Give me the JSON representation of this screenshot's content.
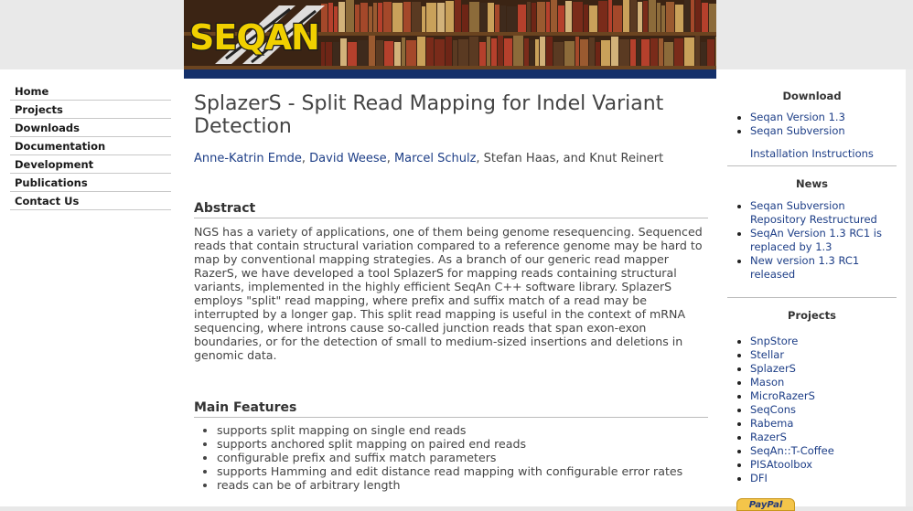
{
  "logo": {
    "text": "SEQAN"
  },
  "nav": {
    "items": [
      "Home",
      "Projects",
      "Downloads",
      "Documentation",
      "Development",
      "Publications",
      "Contact Us"
    ]
  },
  "main": {
    "title": "SplazerS - Split Read Mapping for Indel Variant Detection",
    "authors": {
      "links": [
        "Anne-Katrin Emde",
        "David Weese",
        "Marcel Schulz"
      ],
      "sep": ", ",
      "rest": ", Stefan Haas, and Knut Reinert"
    },
    "abstract_heading": "Abstract",
    "abstract_text": "NGS has a variety of applications, one of them being genome resequencing. Sequenced reads that contain structural variation compared to a reference genome may be hard to map by conventional mapping strategies. As a branch of our generic read mapper RazerS, we have developed a tool SplazerS for mapping reads containing structural variants, implemented in the highly efficient SeqAn C++ software library. SplazerS employs \"split\" read mapping, where prefix and suffix match of a read may be interrupted by a longer gap. This split read mapping is useful in the context of mRNA sequencing, where introns cause so-called junction reads that span exon-exon boundaries, or for the detection of small to medium-sized insertions and deletions in genomic data.",
    "features_heading": "Main Features",
    "features": [
      "supports split mapping on single end reads",
      "supports anchored split mapping on paired end reads",
      "configurable prefix and suffix match parameters",
      "supports Hamming and edit distance read mapping with configurable error rates",
      "reads can be of arbitrary length"
    ]
  },
  "sidebar": {
    "download_heading": "Download",
    "download_links": [
      "Seqan Version 1.3",
      "Seqan Subversion"
    ],
    "install_link": "Installation Instructions",
    "news_heading": "News",
    "news_links": [
      "Seqan Subversion Repository Restructured",
      "SeqAn Version 1.3 RC1 is replaced by 1.3",
      "New version 1.3 RC1 released"
    ],
    "projects_heading": "Projects",
    "projects": [
      "SnpStore",
      "Stellar",
      "SplazerS",
      "Mason",
      "MicroRazerS",
      "SeqCons",
      "Rabema",
      "RazerS",
      "SeqAn::T-Coffee",
      "PISAtoolbox",
      "DFI"
    ],
    "paypal_label": "PayPal"
  }
}
